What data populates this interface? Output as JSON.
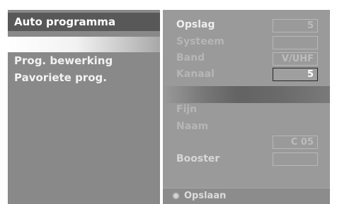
{
  "menu": {
    "items": [
      {
        "label": "Auto programma"
      },
      {
        "label": ""
      },
      {
        "label": "Prog. bewerking"
      },
      {
        "label": "Pavoriete prog."
      }
    ]
  },
  "settings": {
    "opslag_label": "Opslag",
    "opslag_value": "5",
    "systeem_label": "Systeem",
    "systeem_value": "",
    "band_label": "Band",
    "band_value": "V/UHF",
    "kanaal_label": "Kanaal",
    "kanaal_value": "5",
    "fijn_label": "Fijn",
    "naam_label": "Naam",
    "naam_value": "C 05",
    "booster_label": "Booster",
    "booster_value": ""
  },
  "footer": {
    "icon": "circle-button-icon",
    "label": "Opslaan"
  }
}
